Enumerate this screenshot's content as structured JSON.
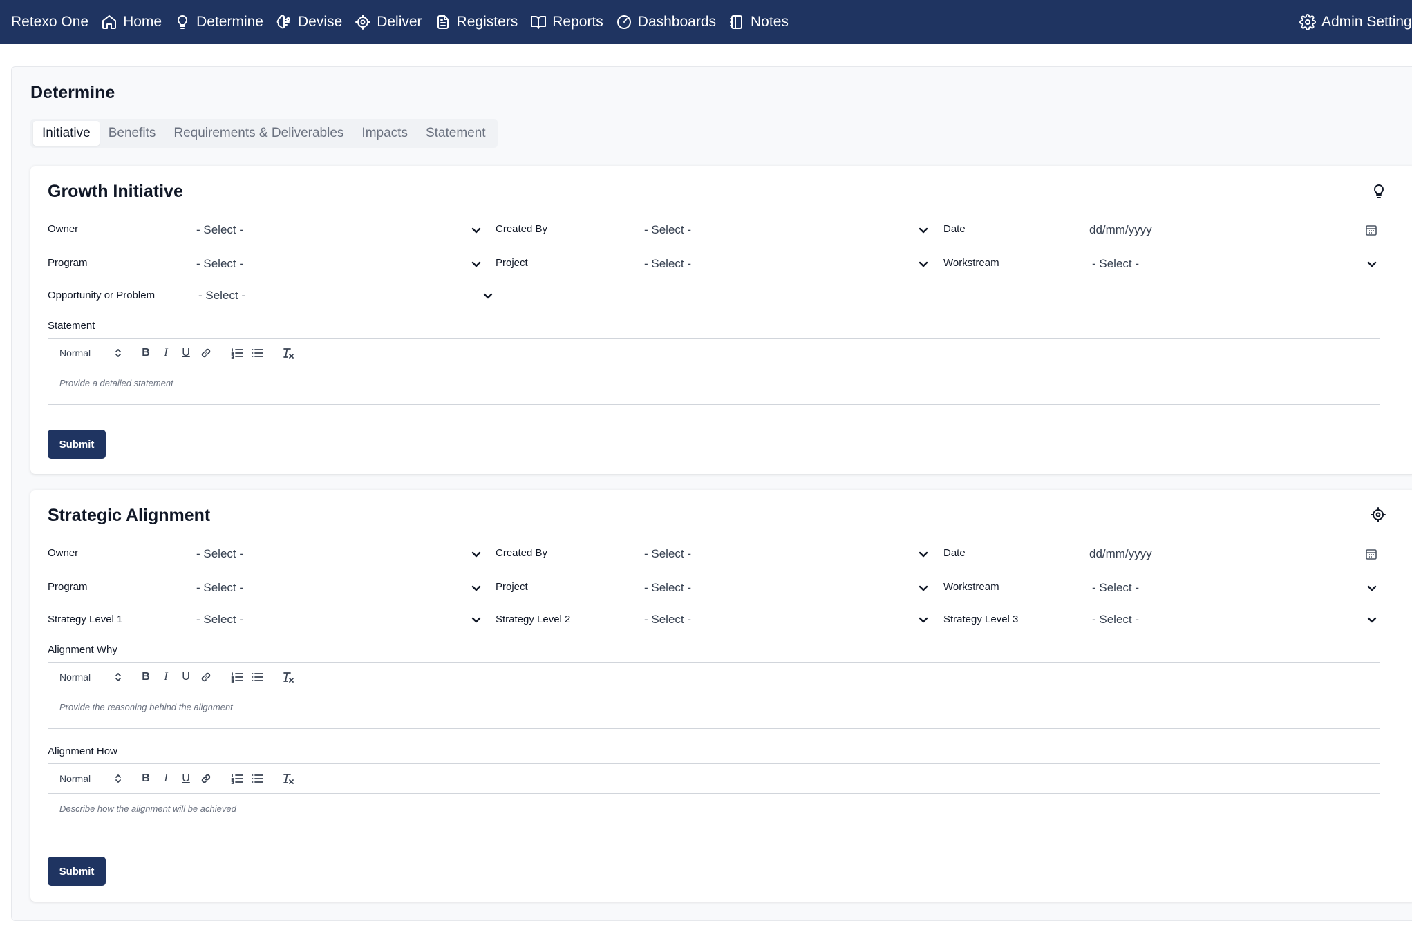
{
  "nav": {
    "brand": "Retexo One",
    "items": [
      {
        "label": "Home",
        "icon": "home-icon"
      },
      {
        "label": "Determine",
        "icon": "lightbulb-icon"
      },
      {
        "label": "Devise",
        "icon": "brain-icon"
      },
      {
        "label": "Deliver",
        "icon": "crosshair-icon"
      },
      {
        "label": "Registers",
        "icon": "document-icon"
      },
      {
        "label": "Reports",
        "icon": "book-open-icon"
      },
      {
        "label": "Dashboards",
        "icon": "gauge-icon"
      },
      {
        "label": "Notes",
        "icon": "notebook-icon"
      }
    ],
    "admin": {
      "label": "Admin Settings",
      "icon": "gear-icon"
    }
  },
  "page": {
    "title": "Determine",
    "tabs": [
      {
        "label": "Initiative",
        "active": true
      },
      {
        "label": "Benefits",
        "active": false
      },
      {
        "label": "Requirements & Deliverables",
        "active": false
      },
      {
        "label": "Impacts",
        "active": false
      },
      {
        "label": "Statement",
        "active": false
      }
    ]
  },
  "growth": {
    "title": "Growth Initiative",
    "icon": "lightbulb-icon",
    "fields": {
      "owner": {
        "label": "Owner",
        "value": "- Select -"
      },
      "created_by": {
        "label": "Created By",
        "value": "- Select -"
      },
      "date": {
        "label": "Date",
        "value": "dd/mm/yyyy"
      },
      "program": {
        "label": "Program",
        "value": "- Select -"
      },
      "project": {
        "label": "Project",
        "value": "- Select -"
      },
      "workstream": {
        "label": "Workstream",
        "value": "- Select -"
      },
      "opportunity": {
        "label": "Opportunity or Problem",
        "value": "- Select -"
      }
    },
    "statement": {
      "label": "Statement",
      "format": "Normal",
      "placeholder": "Provide a detailed statement"
    },
    "submit": "Submit"
  },
  "strategic": {
    "title": "Strategic Alignment",
    "icon": "crosshair-icon",
    "fields": {
      "owner": {
        "label": "Owner",
        "value": "- Select -"
      },
      "created_by": {
        "label": "Created By",
        "value": "- Select -"
      },
      "date": {
        "label": "Date",
        "value": "dd/mm/yyyy"
      },
      "program": {
        "label": "Program",
        "value": "- Select -"
      },
      "project": {
        "label": "Project",
        "value": "- Select -"
      },
      "workstream": {
        "label": "Workstream",
        "value": "- Select -"
      },
      "level1": {
        "label": "Strategy Level 1",
        "value": "- Select -"
      },
      "level2": {
        "label": "Strategy Level 2",
        "value": "- Select -"
      },
      "level3": {
        "label": "Strategy Level 3",
        "value": "- Select -"
      }
    },
    "why": {
      "label": "Alignment Why",
      "format": "Normal",
      "placeholder": "Provide the reasoning behind the alignment"
    },
    "how": {
      "label": "Alignment How",
      "format": "Normal",
      "placeholder": "Describe how the alignment will be achieved"
    },
    "submit": "Submit"
  },
  "toolbar": {
    "bold": "B",
    "italic": "I",
    "underline": "U"
  }
}
